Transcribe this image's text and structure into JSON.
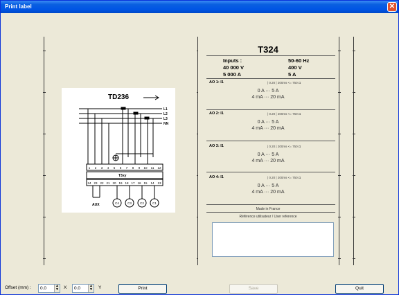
{
  "window": {
    "title": "Print label",
    "close_symbol": "✕"
  },
  "module": {
    "name": "TD236",
    "lines": [
      "L1",
      "L2",
      "L3",
      "NN"
    ],
    "terminals_top": [
      "1",
      "2",
      "3",
      "4",
      "5",
      "6",
      "7",
      "8",
      "9",
      "10",
      "11",
      "12"
    ],
    "device_label": "T3xy",
    "terminals_bottom": [
      "24",
      "23",
      "22",
      "21",
      "20",
      "19",
      "18",
      "17",
      "16",
      "15",
      "14",
      "13"
    ],
    "aux_label": "AUX",
    "outputs": [
      "C4",
      "C3",
      "C2",
      "C1"
    ]
  },
  "label": {
    "model": "T324",
    "inputs_label": "Inputs :",
    "freq": "50-60 Hz",
    "voltage_in": "40 000 V",
    "voltage_out": "400 V",
    "current_in": "5 000 A",
    "current_out": "5 A",
    "channels": [
      {
        "name": "AO 1: I1",
        "spec": "| 0.20 |   200ms   <= 750  Ω",
        "range1": "0 A ··· 5 A",
        "range2": "4 mA ··· 20 mA"
      },
      {
        "name": "AO 2: I1",
        "spec": "| 0.20 |   200ms   <= 750  Ω",
        "range1": "0 A ··· 5 A",
        "range2": "4 mA ··· 20 mA"
      },
      {
        "name": "AO 3: I1",
        "spec": "| 0.20 |   200ms   <= 750  Ω",
        "range1": "0 A ··· 5 A",
        "range2": "4 mA ··· 20 mA"
      },
      {
        "name": "AO 4: I1",
        "spec": "| 0.20 |   200ms   <= 750  Ω",
        "range1": "0 A ··· 5 A",
        "range2": "4 mA ··· 20 mA"
      }
    ],
    "made_in": "Made in France",
    "user_ref": "Référence utilisateur / User reference",
    "user_ref_value": ""
  },
  "controls": {
    "offset_label": "Offset (mm) :",
    "offset_x": "0.0",
    "x_label": "X",
    "offset_y": "0.0",
    "y_label": "Y",
    "print": "Print",
    "save": "Save",
    "quit": "Quit"
  }
}
